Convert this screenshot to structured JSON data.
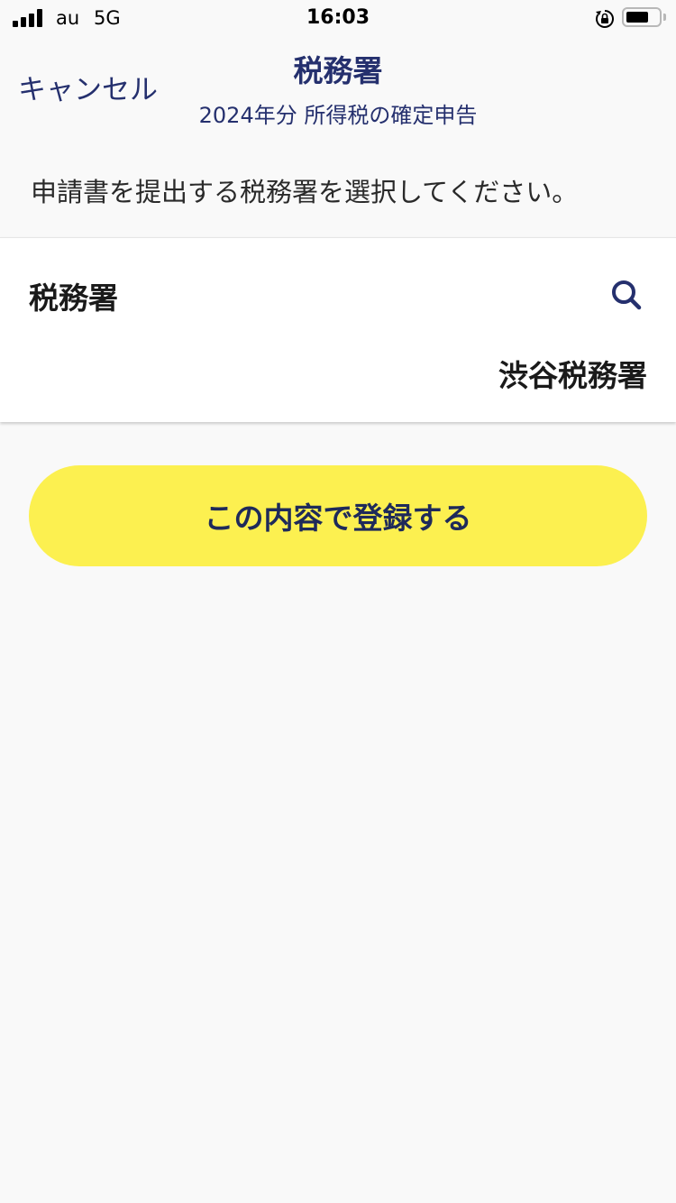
{
  "status_bar": {
    "carrier": "au",
    "network": "5G",
    "time": "16:03",
    "battery_level": 0.7,
    "signal_icon": "signal-bars-icon",
    "lock_icon": "rotation-lock-icon",
    "battery_icon": "battery-icon"
  },
  "nav": {
    "cancel_label": "キャンセル",
    "title": "税務署",
    "subtitle": "2024年分 所得税の確定申告"
  },
  "instruction": "申請書を提出する税務署を選択してください。",
  "field": {
    "label": "税務署",
    "value": "渋谷税務署",
    "search_icon": "search-icon"
  },
  "submit_label": "この内容で登録する",
  "colors": {
    "accent_navy": "#25306e",
    "button_yellow": "#fcf050",
    "background": "#f9f9f9"
  }
}
